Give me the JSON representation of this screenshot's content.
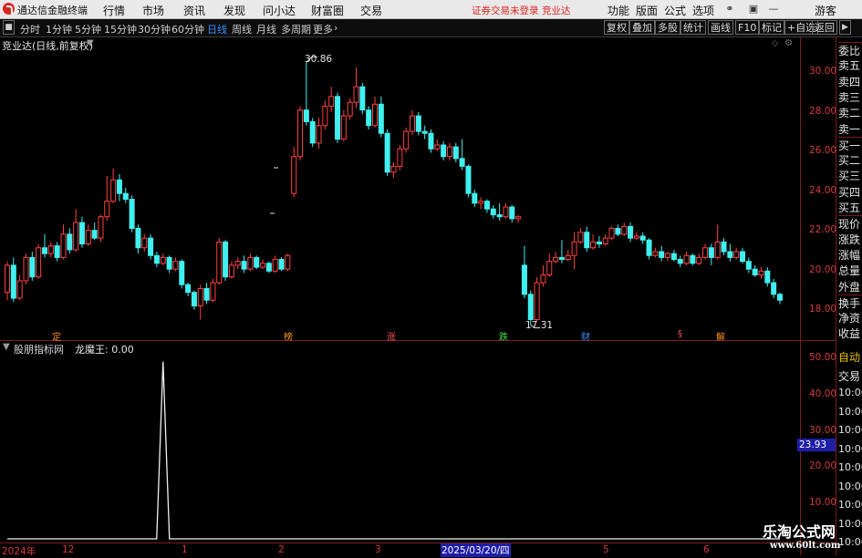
{
  "app": {
    "title": "通达信金融终端"
  },
  "menu": {
    "items": [
      "行情",
      "市场",
      "资讯",
      "发现",
      "问小达",
      "财富圈",
      "交易"
    ]
  },
  "login_notice": "证券交易未登录",
  "account_name": "竞业达",
  "right_menu": [
    "功能",
    "版面",
    "公式",
    "选项"
  ],
  "user_label": "游客",
  "periods": [
    "分时",
    "1分钟",
    "5分钟",
    "15分钟",
    "30分钟",
    "60分钟",
    "日线",
    "周线",
    "月线",
    "多周期",
    "更多"
  ],
  "active_period": "日线",
  "toolbar_buttons": [
    "复权",
    "叠加",
    "多股",
    "统计",
    "画线",
    "F10",
    "标记",
    "+自选",
    "返回"
  ],
  "stock": {
    "header": "竞业达(日线,前复权)"
  },
  "side_panel": [
    "委比",
    "卖五",
    "卖四",
    "卖三",
    "卖二",
    "卖一",
    "买一",
    "买二",
    "买三",
    "买四",
    "买五",
    "现价",
    "涨跌",
    "涨幅",
    "总量",
    "外盘",
    "换手",
    "净资",
    "收益"
  ],
  "side_lower": [
    "自动",
    "交易",
    "10:06",
    "10:06",
    "10:06",
    "10:06",
    "10:06",
    "10:06",
    "10:06",
    "10:06",
    "10:06"
  ],
  "colors": {
    "up": "#ff4040",
    "down": "#40f0f0",
    "frame": "#7a1b1b",
    "axis_text": "#d23a3a",
    "cursor_box": "#1e1ea8",
    "active_tab": "#3a8bff"
  },
  "indicator": {
    "name": "股朋指标网",
    "value_label": "龙魔王: 0.00",
    "current_value": "23.93"
  },
  "annotations": {
    "high": "30.86",
    "low": "17.31"
  },
  "event_markers": [
    {
      "text": "定",
      "color": "#ff9020"
    },
    {
      "text": "榜",
      "color": "#ff9020"
    },
    {
      "text": "涨",
      "color": "#ff5050"
    },
    {
      "text": "跌",
      "color": "#40e040"
    },
    {
      "text": "财",
      "color": "#4090ff"
    },
    {
      "text": "§",
      "color": "#ff5050"
    },
    {
      "text": "解",
      "color": "#ff9020"
    }
  ],
  "x_axis": {
    "labels": [
      "2024年",
      "12",
      "1",
      "2",
      "3",
      "2025/03/20/四",
      "5",
      "6"
    ]
  },
  "watermark": {
    "main": "乐淘公式网",
    "url": "www.60lt.com"
  },
  "chart_data": [
    {
      "type": "candlestick",
      "title": "竞业达(日线,前复权)",
      "y_ticks": [
        "30.00",
        "28.00",
        "26.00",
        "24.00",
        "22.00",
        "20.00",
        "18.00"
      ],
      "ylim": [
        17.2,
        31.3
      ],
      "grid": false,
      "candles": [
        [
          19.0,
          20.4,
          18.6,
          20.6
        ],
        [
          20.4,
          18.7,
          18.5,
          20.8
        ],
        [
          18.7,
          19.6,
          18.6,
          19.9
        ],
        [
          19.6,
          20.8,
          19.4,
          21.0
        ],
        [
          20.8,
          19.8,
          19.6,
          21.1
        ],
        [
          19.8,
          21.3,
          19.7,
          21.5
        ],
        [
          21.3,
          21.0,
          20.8,
          22.0
        ],
        [
          21.0,
          21.4,
          20.8,
          21.6
        ],
        [
          21.4,
          20.8,
          20.6,
          21.6
        ],
        [
          20.8,
          22.0,
          20.7,
          22.5
        ],
        [
          22.0,
          21.2,
          21.0,
          22.3
        ],
        [
          21.2,
          22.6,
          21.1,
          23.3
        ],
        [
          22.6,
          21.5,
          21.3,
          22.9
        ],
        [
          21.5,
          22.2,
          21.4,
          22.5
        ],
        [
          22.2,
          21.8,
          21.7,
          22.6
        ],
        [
          21.8,
          22.9,
          21.6,
          23.0
        ],
        [
          22.9,
          23.7,
          22.7,
          25.0
        ],
        [
          23.7,
          24.8,
          23.6,
          25.4
        ],
        [
          24.8,
          24.1,
          23.7,
          25.1
        ],
        [
          24.1,
          23.8,
          23.6,
          24.4
        ],
        [
          23.8,
          22.3,
          22.1,
          24.0
        ],
        [
          22.3,
          21.3,
          21.0,
          22.5
        ],
        [
          21.3,
          21.8,
          21.1,
          22.0
        ],
        [
          21.8,
          20.9,
          20.7,
          22.0
        ],
        [
          20.9,
          20.5,
          20.3,
          21.1
        ],
        [
          20.5,
          20.8,
          20.4,
          21.0
        ],
        [
          20.8,
          20.2,
          20.0,
          20.9
        ],
        [
          20.2,
          20.6,
          20.1,
          20.8
        ],
        [
          20.6,
          19.4,
          19.2,
          20.7
        ],
        [
          19.4,
          19.0,
          18.8,
          19.5
        ],
        [
          19.0,
          18.3,
          18.1,
          19.1
        ],
        [
          18.3,
          19.2,
          17.6,
          19.4
        ],
        [
          19.2,
          18.6,
          18.4,
          19.5
        ],
        [
          18.6,
          19.5,
          18.5,
          19.7
        ],
        [
          19.5,
          21.6,
          19.4,
          21.8
        ],
        [
          21.6,
          19.8,
          19.6,
          21.7
        ],
        [
          19.8,
          20.4,
          19.7,
          20.6
        ],
        [
          20.4,
          20.6,
          20.2,
          20.8
        ],
        [
          20.6,
          20.2,
          20.0,
          20.9
        ],
        [
          20.2,
          20.8,
          20.1,
          21.0
        ],
        [
          20.8,
          20.3,
          20.2,
          20.9
        ],
        [
          20.3,
          20.5,
          20.2,
          20.7
        ],
        [
          20.5,
          20.1,
          20.0,
          20.6
        ],
        [
          20.1,
          20.7,
          20.0,
          20.9
        ],
        [
          20.7,
          20.2,
          20.1,
          20.8
        ],
        [
          20.2,
          20.9,
          20.1,
          21.0
        ],
        [
          24.1,
          26.0,
          23.9,
          26.5
        ],
        [
          26.0,
          28.4,
          25.8,
          28.6
        ],
        [
          28.4,
          27.8,
          27.6,
          30.86
        ],
        [
          27.8,
          26.7,
          26.5,
          28.0
        ],
        [
          26.7,
          27.6,
          26.4,
          28.0
        ],
        [
          27.6,
          28.6,
          27.4,
          28.9
        ],
        [
          28.6,
          29.1,
          28.3,
          29.6
        ],
        [
          29.1,
          26.9,
          26.7,
          29.3
        ],
        [
          26.9,
          28.1,
          26.8,
          28.4
        ],
        [
          28.1,
          28.8,
          27.9,
          29.0
        ],
        [
          28.8,
          29.6,
          28.5,
          30.6
        ],
        [
          29.6,
          28.4,
          28.2,
          29.8
        ],
        [
          28.4,
          27.6,
          27.4,
          28.6
        ],
        [
          27.6,
          28.7,
          27.5,
          29.1
        ],
        [
          28.7,
          27.2,
          27.0,
          29.1
        ],
        [
          27.2,
          25.2,
          25.0,
          27.4
        ],
        [
          25.2,
          25.5,
          24.9,
          25.7
        ],
        [
          25.5,
          26.4,
          25.3,
          26.6
        ],
        [
          26.4,
          27.3,
          26.2,
          27.5
        ],
        [
          27.3,
          28.1,
          27.1,
          28.4
        ],
        [
          28.1,
          27.3,
          27.1,
          28.3
        ],
        [
          27.3,
          27.2,
          26.9,
          27.6
        ],
        [
          27.2,
          26.4,
          26.2,
          27.4
        ],
        [
          26.4,
          26.6,
          26.3,
          26.9
        ],
        [
          26.6,
          26.0,
          25.8,
          26.8
        ],
        [
          26.0,
          26.5,
          25.8,
          26.7
        ],
        [
          26.5,
          25.9,
          25.7,
          26.7
        ],
        [
          25.9,
          25.5,
          25.3,
          26.9
        ],
        [
          25.5,
          24.1,
          23.9,
          25.6
        ],
        [
          24.1,
          23.6,
          23.4,
          24.3
        ],
        [
          23.6,
          23.7,
          23.3,
          23.9
        ],
        [
          23.7,
          23.3,
          23.1,
          23.8
        ],
        [
          23.3,
          23.0,
          22.8,
          23.5
        ],
        [
          23.0,
          22.9,
          22.7,
          23.6
        ],
        [
          22.9,
          23.4,
          22.8,
          23.6
        ],
        [
          23.4,
          22.8,
          22.6,
          23.5
        ],
        [
          22.8,
          22.9,
          22.6,
          23.0
        ],
        [
          20.4,
          18.9,
          18.7,
          21.4
        ],
        [
          18.9,
          17.6,
          17.31,
          19.1
        ],
        [
          17.6,
          19.5,
          17.5,
          19.8
        ],
        [
          19.5,
          19.9,
          19.3,
          20.4
        ],
        [
          19.9,
          20.6,
          19.8,
          21.0
        ],
        [
          20.6,
          20.8,
          20.5,
          21.1
        ],
        [
          20.8,
          20.7,
          20.5,
          21.7
        ],
        [
          20.7,
          20.9,
          20.6,
          21.2
        ],
        [
          20.9,
          21.6,
          20.2,
          22.1
        ],
        [
          21.6,
          22.1,
          21.5,
          22.3
        ],
        [
          22.1,
          21.3,
          21.1,
          22.4
        ],
        [
          21.3,
          21.6,
          21.2,
          22.0
        ],
        [
          21.6,
          21.5,
          21.3,
          21.9
        ],
        [
          21.5,
          21.8,
          21.4,
          22.0
        ],
        [
          21.8,
          22.3,
          21.7,
          22.4
        ],
        [
          22.3,
          22.0,
          21.9,
          22.5
        ],
        [
          22.0,
          22.4,
          21.9,
          22.6
        ],
        [
          22.4,
          21.8,
          21.6,
          22.6
        ],
        [
          21.8,
          21.9,
          21.7,
          22.1
        ],
        [
          21.9,
          21.7,
          21.5,
          22.1
        ],
        [
          21.7,
          20.9,
          20.7,
          21.8
        ],
        [
          20.9,
          21.1,
          20.8,
          21.3
        ],
        [
          21.1,
          20.8,
          20.6,
          21.4
        ],
        [
          20.8,
          21.0,
          20.6,
          21.1
        ],
        [
          21.0,
          20.7,
          20.6,
          21.2
        ],
        [
          20.7,
          20.5,
          20.3,
          20.9
        ],
        [
          20.5,
          20.9,
          20.4,
          21.1
        ],
        [
          20.9,
          20.5,
          20.4,
          21.0
        ],
        [
          20.5,
          20.8,
          20.4,
          21.0
        ],
        [
          20.8,
          21.3,
          20.7,
          21.5
        ],
        [
          21.3,
          20.8,
          20.4,
          21.5
        ],
        [
          20.8,
          21.6,
          20.7,
          22.5
        ],
        [
          21.6,
          21.1,
          20.9,
          21.8
        ],
        [
          21.1,
          20.8,
          20.6,
          21.5
        ],
        [
          20.8,
          21.1,
          20.7,
          21.3
        ],
        [
          21.1,
          20.6,
          20.5,
          21.3
        ],
        [
          20.6,
          20.2,
          20.0,
          20.8
        ],
        [
          20.2,
          19.9,
          19.8,
          20.4
        ],
        [
          19.9,
          20.1,
          19.7,
          20.3
        ],
        [
          20.1,
          19.5,
          19.3,
          20.3
        ],
        [
          19.5,
          18.9,
          18.7,
          19.7
        ],
        [
          18.9,
          18.6,
          18.4,
          19.0
        ]
      ]
    },
    {
      "type": "line",
      "title": "股朋指标网 龙魔王",
      "y_ticks": [
        "50.00",
        "40.00",
        "30.00",
        "20.00",
        "10.00"
      ],
      "ylim": [
        0,
        55
      ],
      "series": [
        {
          "name": "龙魔王",
          "peak_index": 25,
          "peak_value": 50.2,
          "baseline": 0
        }
      ]
    }
  ]
}
